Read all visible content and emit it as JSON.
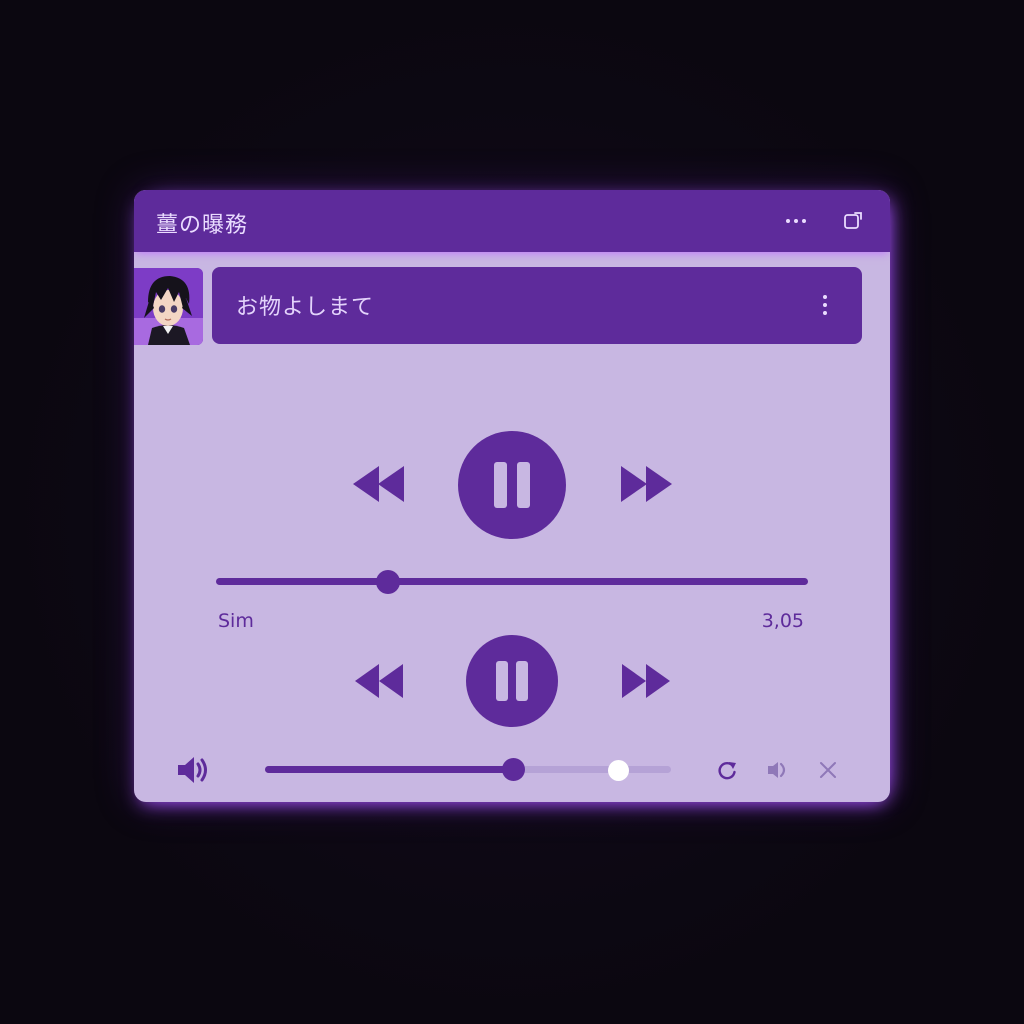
{
  "window": {
    "title": "薑の曝務"
  },
  "track": {
    "title": "お物よしまて"
  },
  "playback": {
    "elapsed": "Sim",
    "duration": "3,05",
    "progress": 0.29
  },
  "volume": {
    "level": 0.61,
    "secondary_level": 0.87
  },
  "colors": {
    "accent": "#5e2b9b",
    "panel": "#c8b7e2",
    "glow": "#a852ff",
    "background": "#0c0812"
  },
  "icons": {
    "more": "more-horizontal-icon",
    "popout": "popout-window-icon",
    "track_menu": "more-vertical-icon",
    "rewind": "rewind-icon",
    "pause": "pause-icon",
    "fast_forward": "fast-forward-icon",
    "volume": "volume-icon",
    "repeat": "repeat-icon",
    "cast": "cast-audio-icon",
    "close": "close-icon"
  }
}
